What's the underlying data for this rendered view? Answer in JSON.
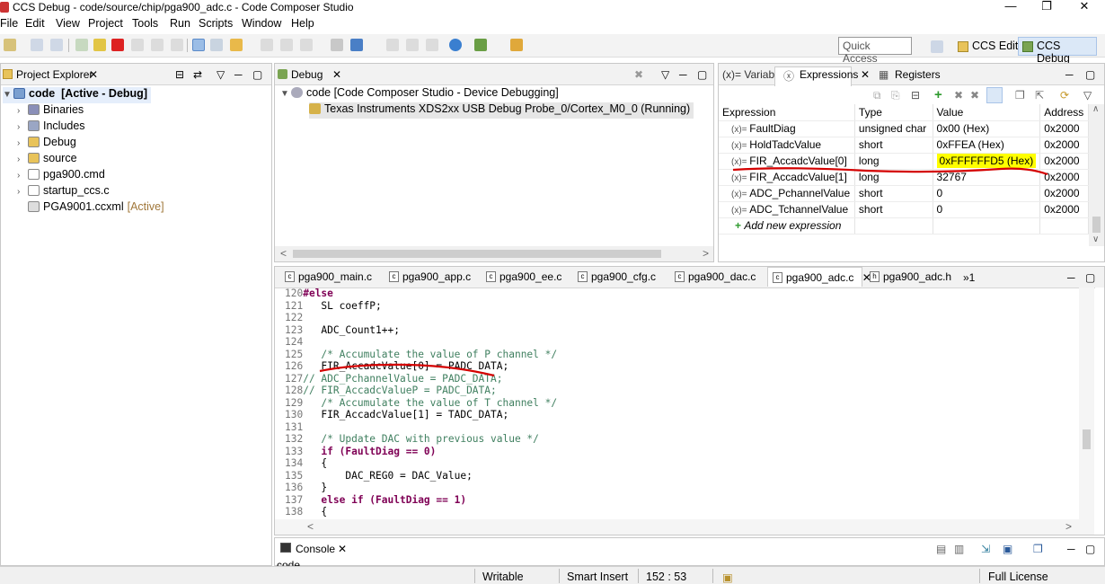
{
  "window": {
    "title": "CCS Debug - code/source/chip/pga900_adc.c - Code Composer Studio",
    "minimize": "—",
    "maximize": "❐",
    "close": "✕"
  },
  "menu": [
    "File",
    "Edit",
    "View",
    "Project",
    "Tools",
    "Run",
    "Scripts",
    "Window",
    "Help"
  ],
  "toolbar": {
    "quick_access_placeholder": "Quick Access",
    "perspectives": [
      "CCS Edit",
      "CCS Debug"
    ]
  },
  "project_explorer": {
    "tab": "Project Explorer",
    "root": {
      "name": "code",
      "status": "[Active - Debug]"
    },
    "items": [
      {
        "label": "Binaries",
        "icon": "binaries-icon",
        "expandable": true
      },
      {
        "label": "Includes",
        "icon": "includes-icon",
        "expandable": true
      },
      {
        "label": "Debug",
        "icon": "folder-icon",
        "expandable": true
      },
      {
        "label": "source",
        "icon": "folder-icon",
        "expandable": true
      },
      {
        "label": "pga900.cmd",
        "icon": "file-icon",
        "expandable": true
      },
      {
        "label": "startup_ccs.c",
        "icon": "c-file-icon",
        "expandable": true
      },
      {
        "label": "PGA9001.ccxml",
        "icon": "ccxml-icon",
        "expandable": false,
        "suffix": "[Active]"
      }
    ]
  },
  "debug_view": {
    "tab": "Debug",
    "session": "code [Code Composer Studio - Device Debugging]",
    "target": "Texas Instruments XDS2xx USB Debug Probe_0/Cortex_M0_0 (Running)"
  },
  "expressions_view": {
    "tabs": [
      "(x)= Variables",
      "Expressions",
      "Registers"
    ],
    "columns": [
      "Expression",
      "Type",
      "Value",
      "Address"
    ],
    "rows": [
      {
        "name": "FaultDiag",
        "type": "unsigned char",
        "value": "0x00 (Hex)",
        "addr": "0x2000"
      },
      {
        "name": "HoldTadcValue",
        "type": "short",
        "value": "0xFFEA (Hex)",
        "addr": "0x2000"
      },
      {
        "name": "FIR_AccadcValue[0]",
        "type": "long",
        "value": "0xFFFFFFD5 (Hex)",
        "addr": "0x2000",
        "highlight": true
      },
      {
        "name": "FIR_AccadcValue[1]",
        "type": "long",
        "value": "32767",
        "addr": "0x2000"
      },
      {
        "name": "ADC_PchannelValue",
        "type": "short",
        "value": "0",
        "addr": "0x2000"
      },
      {
        "name": "ADC_TchannelValue",
        "type": "short",
        "value": "0",
        "addr": "0x2000"
      }
    ],
    "add_new": "Add new expression",
    "highlight_color": "#ffff00",
    "annotation_color": "#d40000"
  },
  "editor": {
    "tabs": [
      "pga900_main.c",
      "pga900_app.c",
      "pga900_ee.c",
      "pga900_cfg.c",
      "pga900_dac.c",
      "pga900_adc.c",
      "pga900_adc.h"
    ],
    "active_tab": "pga900_adc.c",
    "overflow": "»1",
    "lines": [
      {
        "n": "120",
        "t": "#else"
      },
      {
        "n": "121",
        "t": "   SL coeffP;"
      },
      {
        "n": "122",
        "t": ""
      },
      {
        "n": "123",
        "t": "   ADC_Count1++;"
      },
      {
        "n": "124",
        "t": ""
      },
      {
        "n": "125",
        "t": "   /* Accumulate the value of P channel */"
      },
      {
        "n": "126",
        "t": "   FIR_AccadcValue[0] = PADC_DATA;"
      },
      {
        "n": "127",
        "t": "// ADC_PchannelValue = PADC_DATA;"
      },
      {
        "n": "128",
        "t": "// FIR_AccadcValueP = PADC_DATA;"
      },
      {
        "n": "129",
        "t": "   /* Accumulate the value of T channel */"
      },
      {
        "n": "130",
        "t": "   FIR_AccadcValue[1] = TADC_DATA;"
      },
      {
        "n": "131",
        "t": ""
      },
      {
        "n": "132",
        "t": "   /* Update DAC with previous value */"
      },
      {
        "n": "133",
        "t": "   if (FaultDiag == 0)"
      },
      {
        "n": "134",
        "t": "   {"
      },
      {
        "n": "135",
        "t": "       DAC_REG0 = DAC_Value;"
      },
      {
        "n": "136",
        "t": "   }"
      },
      {
        "n": "137",
        "t": "   else if (FaultDiag == 1)"
      },
      {
        "n": "138",
        "t": "   {"
      }
    ]
  },
  "console": {
    "tab": "Console",
    "text": "code"
  },
  "status": {
    "writable": "Writable",
    "insert_mode": "Smart Insert",
    "position": "152 : 53",
    "license": "Full License"
  }
}
